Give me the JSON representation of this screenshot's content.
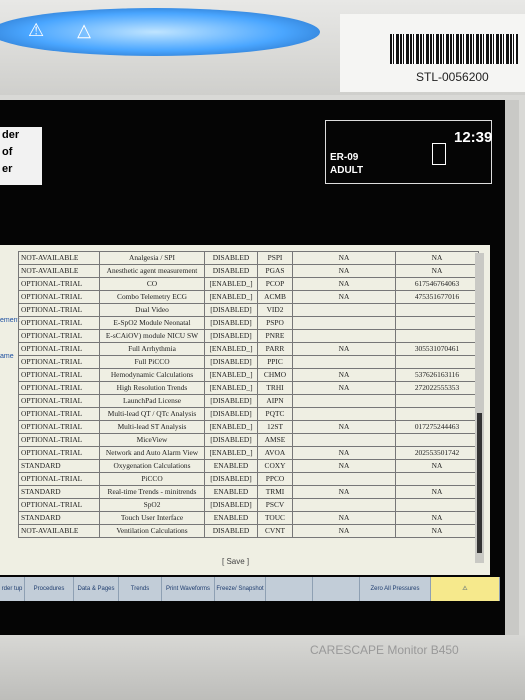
{
  "device": {
    "asset_tag": "STL-0056200",
    "brand": "CARESCAPE Monitor B450",
    "alarm_icons": "⚠ △"
  },
  "screen": {
    "left_labels": [
      "der",
      "of",
      "er"
    ],
    "side_labels": [
      "ement",
      "ame"
    ],
    "bed_label": "ER-09",
    "patient_type": "ADULT",
    "clock": "12:39"
  },
  "table": {
    "rows": [
      [
        "NOT-AVAILABLE",
        "Analgesia / SPI",
        "DISABLED",
        "PSPI",
        "NA",
        "NA"
      ],
      [
        "NOT-AVAILABLE",
        "Anesthetic agent measurement",
        "DISABLED",
        "PGAS",
        "NA",
        "NA"
      ],
      [
        "OPTIONAL-TRIAL",
        "CO",
        "[ENABLED_]",
        "PCOP",
        "NA",
        "617546764063"
      ],
      [
        "OPTIONAL-TRIAL",
        "Combo Telemetry ECG",
        "[ENABLED_]",
        "ACMB",
        "NA",
        "475351677016"
      ],
      [
        "OPTIONAL-TRIAL",
        "Dual Video",
        "[DISABLED]",
        "VID2",
        "",
        ""
      ],
      [
        "OPTIONAL-TRIAL",
        "E-SpO2 Module Neonatal",
        "[DISABLED]",
        "PSPO",
        "",
        ""
      ],
      [
        "OPTIONAL-TRIAL",
        "E-sCAiOV) module NICU SW",
        "[DISABLED]",
        "PNRE",
        "",
        ""
      ],
      [
        "OPTIONAL-TRIAL",
        "Full Arrhythmia",
        "[ENABLED_]",
        "PARR",
        "NA",
        "305531070461"
      ],
      [
        "OPTIONAL-TRIAL",
        "Full PiCCO",
        "[DISABLED]",
        "PPIC",
        "",
        ""
      ],
      [
        "OPTIONAL-TRIAL",
        "Hemodynamic Calculations",
        "[ENABLED_]",
        "CHMO",
        "NA",
        "537626163116"
      ],
      [
        "OPTIONAL-TRIAL",
        "High Resolution Trends",
        "[ENABLED_]",
        "TRHI",
        "NA",
        "272022555353"
      ],
      [
        "OPTIONAL-TRIAL",
        "LaunchPad License",
        "[DISABLED]",
        "AIPN",
        "",
        ""
      ],
      [
        "OPTIONAL-TRIAL",
        "Multi-lead QT / QTc Analysis",
        "[DISABLED]",
        "PQTC",
        "",
        ""
      ],
      [
        "OPTIONAL-TRIAL",
        "Multi-lead ST Analysis",
        "[ENABLED_]",
        "12ST",
        "NA",
        "017275244463"
      ],
      [
        "OPTIONAL-TRIAL",
        "MiceView",
        "[DISABLED]",
        "AMSE",
        "",
        ""
      ],
      [
        "OPTIONAL-TRIAL",
        "Network and Auto Alarm View",
        "[ENABLED_]",
        "AVOA",
        "NA",
        "202553501742"
      ],
      [
        "STANDARD",
        "Oxygenation Calculations",
        "ENABLED",
        "COXY",
        "NA",
        "NA"
      ],
      [
        "OPTIONAL-TRIAL",
        "PiCCO",
        "[DISABLED]",
        "PPCO",
        "",
        ""
      ],
      [
        "STANDARD",
        "Real-time Trends - minitrends",
        "ENABLED",
        "TRMI",
        "NA",
        "NA"
      ],
      [
        "OPTIONAL-TRIAL",
        "SpO2",
        "[DISABLED]",
        "PSCV",
        "",
        ""
      ],
      [
        "STANDARD",
        "Touch User Interface",
        "ENABLED",
        "TOUC",
        "NA",
        "NA"
      ],
      [
        "NOT-AVAILABLE",
        "Ventilation Calculations",
        "DISABLED",
        "CVNT",
        "NA",
        "NA"
      ]
    ],
    "save_label": "[ Save ]"
  },
  "menu": {
    "items": [
      "rder tup",
      "Procedures",
      "Data & Pages",
      "Trends",
      "Print Waveforms",
      "Freeze/ Snapshot",
      "",
      "",
      "Zero All Pressures",
      "⚠"
    ]
  }
}
